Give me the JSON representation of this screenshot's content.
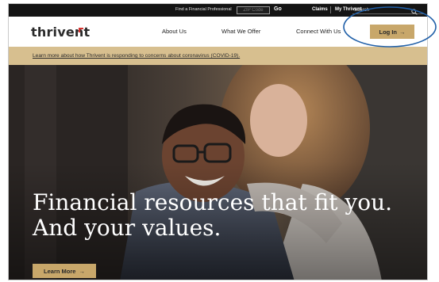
{
  "utility": {
    "find_professional": "Find a Financial Professional",
    "zip_placeholder": "ZIP Code",
    "go_label": "Go",
    "claims_label": "Claims",
    "my_thrivent_label": "My Thrivent",
    "search_placeholder": "Search"
  },
  "nav": {
    "logo": "thrivent",
    "links": [
      "About Us",
      "What We Offer",
      "Connect With Us"
    ],
    "login_label": "Log In",
    "arrow": "→"
  },
  "banner": {
    "text": "Learn more about how Thrivent is responding to concerns about coronavirus (COVID-19)."
  },
  "hero": {
    "title_line1": "Financial resources that fit you.",
    "title_line2": "And your values.",
    "cta_label": "Learn More",
    "arrow": "→"
  },
  "colors": {
    "accent_gold": "#c8a76a",
    "banner_bg": "#d7bf8f",
    "utility_bg": "#141414",
    "logo_red": "#d6322f",
    "annotation_blue": "#1f5fa8"
  }
}
